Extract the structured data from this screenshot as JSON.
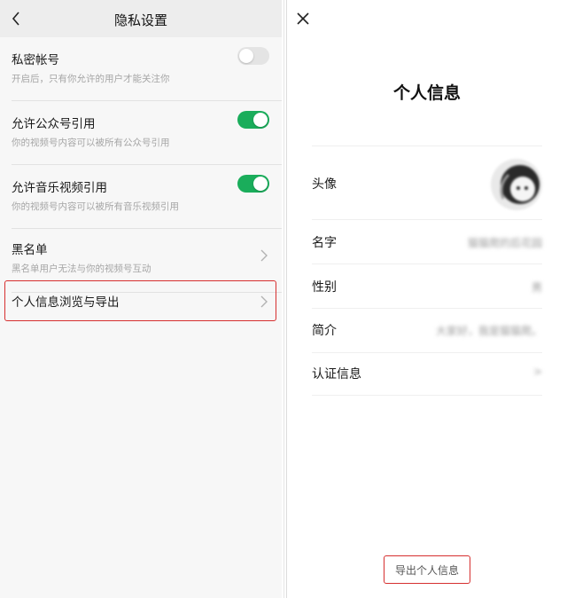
{
  "left": {
    "title": "隐私设置",
    "rows": [
      {
        "title": "私密帐号",
        "desc": "开启后，只有你允许的用户才能关注你",
        "control": "toggle",
        "on": false
      },
      {
        "title": "允许公众号引用",
        "desc": "你的视频号内容可以被所有公众号引用",
        "control": "toggle",
        "on": true
      },
      {
        "title": "允许音乐视频引用",
        "desc": "你的视频号内容可以被所有音乐视频引用",
        "control": "toggle",
        "on": true
      },
      {
        "title": "黑名单",
        "desc": "黑名单用户无法与你的视频号互动",
        "control": "chevron"
      },
      {
        "title": "个人信息浏览与导出",
        "desc": "",
        "control": "chevron",
        "highlighted": true
      }
    ]
  },
  "right": {
    "title": "个人信息",
    "rows": [
      {
        "label": "头像",
        "value": ""
      },
      {
        "label": "名字",
        "value": "猫猫爬的后花园"
      },
      {
        "label": "性别",
        "value": "男"
      },
      {
        "label": "简介",
        "value": "大家好，我是猫猫爬。"
      },
      {
        "label": "认证信息",
        "value": ">"
      }
    ],
    "export_button": "导出个人信息"
  },
  "colors": {
    "toggle_on": "#1aad5b",
    "highlight_border": "#d62f2f",
    "background": "#ededed"
  },
  "icons": [
    "back-arrow-icon",
    "close-icon",
    "chevron-right-icon"
  ]
}
